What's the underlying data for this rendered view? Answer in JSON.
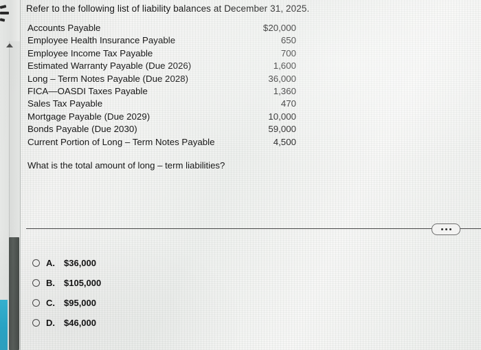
{
  "prompt": "Refer to the following list of liability balances at December 31, 2025.",
  "balances": {
    "rows": [
      {
        "label": "Accounts Payable",
        "amount": "$20,000"
      },
      {
        "label": "Employee Health Insurance Payable",
        "amount": "650"
      },
      {
        "label": "Employee Income Tax Payable",
        "amount": "700"
      },
      {
        "label": "Estimated Warranty Payable (Due 2026)",
        "amount": "1,600"
      },
      {
        "label": "Long – Term Notes Payable (Due 2028)",
        "amount": "36,000"
      },
      {
        "label": "FICA—OASDI Taxes Payable",
        "amount": "1,360"
      },
      {
        "label": "Sales Tax Payable",
        "amount": "470"
      },
      {
        "label": "Mortgage Payable (Due 2029)",
        "amount": "10,000"
      },
      {
        "label": "Bonds Payable (Due 2030)",
        "amount": "59,000"
      },
      {
        "label": "Current Portion of Long – Term Notes Payable",
        "amount": "4,500"
      }
    ]
  },
  "question": "What is the total amount of long – term liabilities?",
  "choices": [
    {
      "letter": "A.",
      "value": "$36,000"
    },
    {
      "letter": "B.",
      "value": "$105,000"
    },
    {
      "letter": "C.",
      "value": "$95,000"
    },
    {
      "letter": "D.",
      "value": "$46,000"
    }
  ],
  "more_options": {
    "icon": "ellipsis-icon"
  },
  "scrollbar": {
    "up_arrow_icon": "scroll-up-arrow-icon"
  },
  "colors": {
    "accent_teal": "#2aa9cb",
    "text": "#171717",
    "divider": "#4a4a4a",
    "scroll_thumb": "#4d524f"
  }
}
